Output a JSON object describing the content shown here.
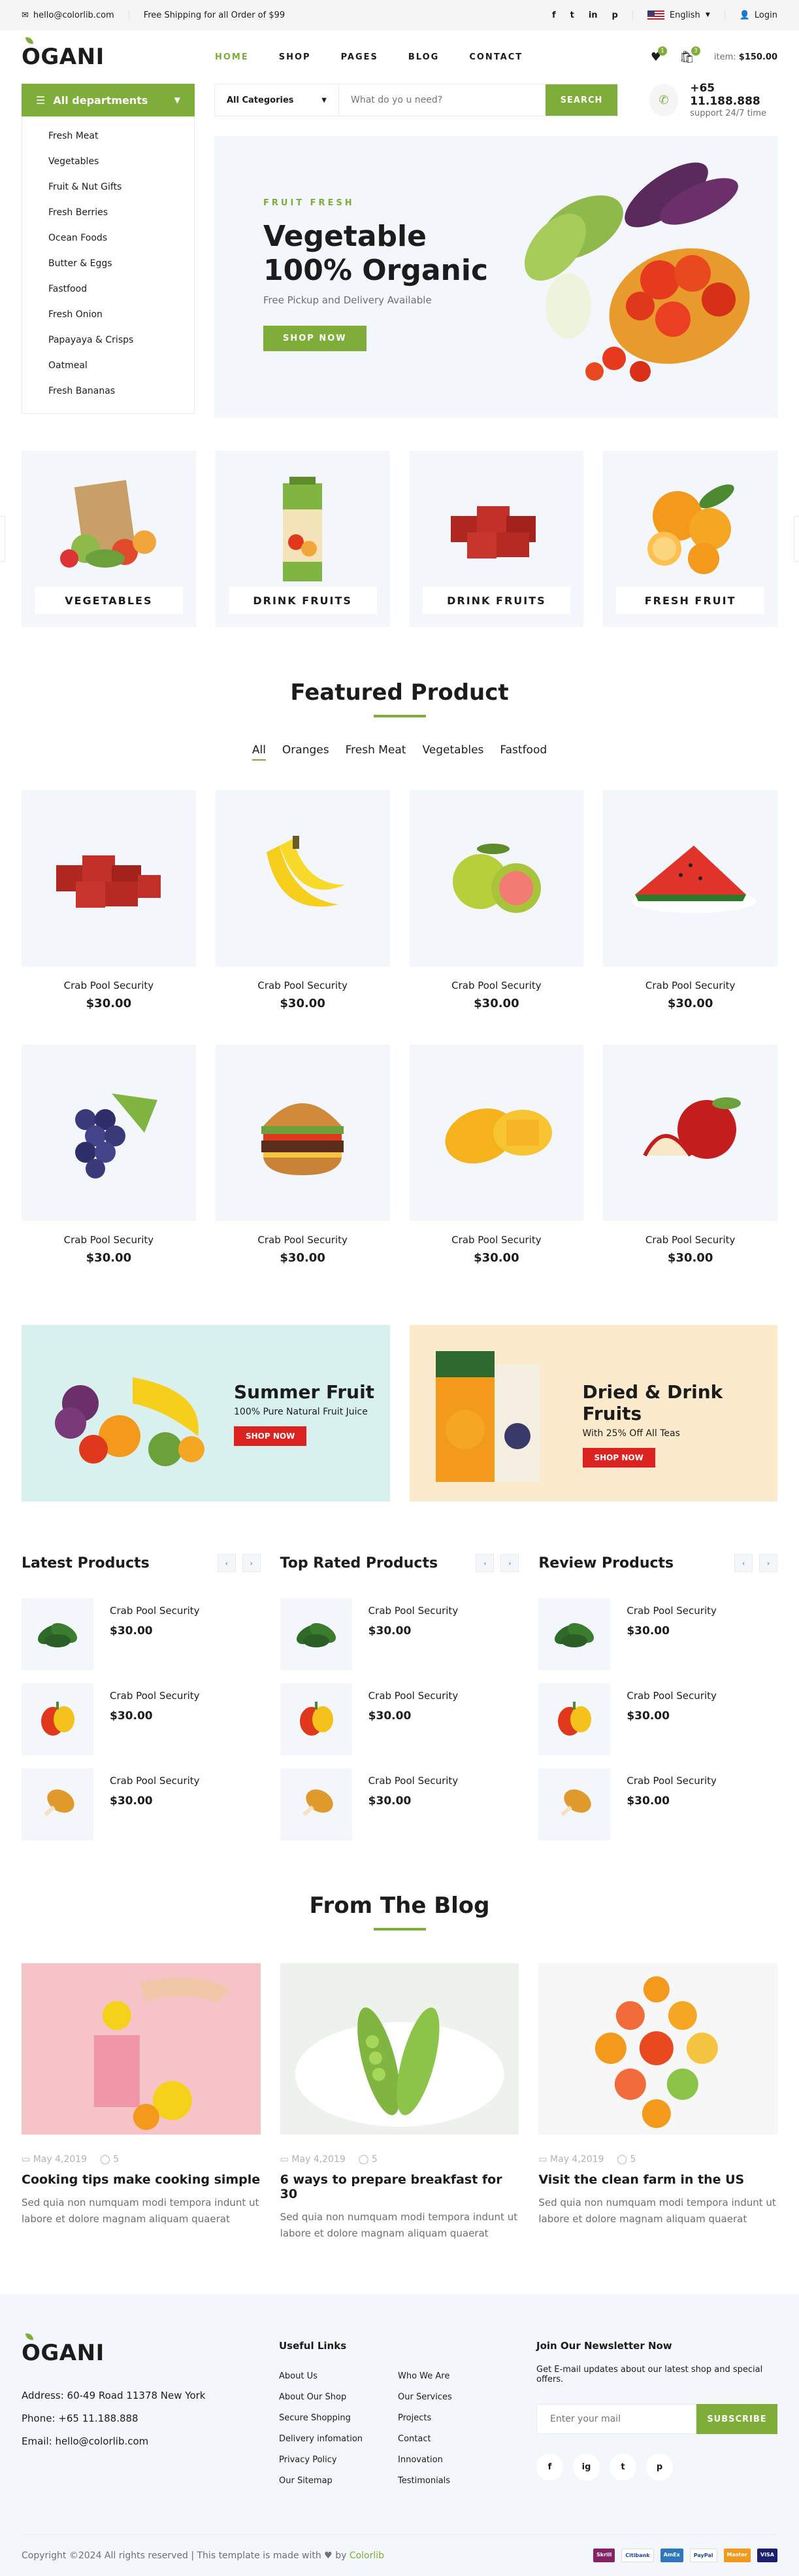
{
  "topbar": {
    "email": "hello@colorlib.com",
    "shipping": "Free Shipping for all Order of $99",
    "social": [
      "f",
      "t",
      "in",
      "p"
    ],
    "language": "English",
    "login": "Login"
  },
  "header": {
    "logo": "OGANI",
    "nav": [
      "HOME",
      "SHOP",
      "PAGES",
      "BLOG",
      "CONTACT"
    ],
    "wishlist_count": "1",
    "cart_count": "3",
    "item_label": "item:",
    "item_price": "$150.00"
  },
  "departments": {
    "title": "All departments",
    "items": [
      "Fresh Meat",
      "Vegetables",
      "Fruit & Nut Gifts",
      "Fresh Berries",
      "Ocean Foods",
      "Butter & Eggs",
      "Fastfood",
      "Fresh Onion",
      "Papayaya & Crisps",
      "Oatmeal",
      "Fresh Bananas"
    ]
  },
  "search": {
    "category": "All Categories",
    "placeholder": "What do yo u need?",
    "button": "SEARCH"
  },
  "phone": {
    "number": "+65 11.188.888",
    "support": "support 24/7 time"
  },
  "banner": {
    "kicker": "FRUIT FRESH",
    "title_line1": "Vegetable",
    "title_line2": "100% Organic",
    "subtitle": "Free Pickup and Delivery Available",
    "button": "SHOP NOW"
  },
  "categories": [
    "VEGETABLES",
    "DRINK FRUITS",
    "DRINK FRUITS",
    "FRESH FRUIT"
  ],
  "featured": {
    "title": "Featured Product",
    "filters": [
      "All",
      "Oranges",
      "Fresh Meat",
      "Vegetables",
      "Fastfood"
    ],
    "products": [
      {
        "name": "Crab Pool Security",
        "price": "$30.00"
      },
      {
        "name": "Crab Pool Security",
        "price": "$30.00"
      },
      {
        "name": "Crab Pool Security",
        "price": "$30.00"
      },
      {
        "name": "Crab Pool Security",
        "price": "$30.00"
      },
      {
        "name": "Crab Pool Security",
        "price": "$30.00"
      },
      {
        "name": "Crab Pool Security",
        "price": "$30.00"
      },
      {
        "name": "Crab Pool Security",
        "price": "$30.00"
      },
      {
        "name": "Crab Pool Security",
        "price": "$30.00"
      }
    ]
  },
  "promos": [
    {
      "title": "Summer Fruit",
      "subtitle": "100% Pure Natural Fruit Juice",
      "button": "SHOP NOW"
    },
    {
      "title": "Dried & Drink Fruits",
      "subtitle": "With 25% Off All Teas",
      "button": "SHOP NOW"
    }
  ],
  "lists": [
    {
      "title": "Latest Products",
      "items": [
        {
          "name": "Crab Pool Security",
          "price": "$30.00"
        },
        {
          "name": "Crab Pool Security",
          "price": "$30.00"
        },
        {
          "name": "Crab Pool Security",
          "price": "$30.00"
        }
      ]
    },
    {
      "title": "Top Rated Products",
      "items": [
        {
          "name": "Crab Pool Security",
          "price": "$30.00"
        },
        {
          "name": "Crab Pool Security",
          "price": "$30.00"
        },
        {
          "name": "Crab Pool Security",
          "price": "$30.00"
        }
      ]
    },
    {
      "title": "Review Products",
      "items": [
        {
          "name": "Crab Pool Security",
          "price": "$30.00"
        },
        {
          "name": "Crab Pool Security",
          "price": "$30.00"
        },
        {
          "name": "Crab Pool Security",
          "price": "$30.00"
        }
      ]
    }
  ],
  "blog": {
    "title": "From The Blog",
    "posts": [
      {
        "date": "May 4,2019",
        "comments": "5",
        "title": "Cooking tips make cooking simple",
        "excerpt": "Sed quia non numquam modi tempora indunt ut labore et dolore magnam aliquam quaerat"
      },
      {
        "date": "May 4,2019",
        "comments": "5",
        "title": "6 ways to prepare breakfast for 30",
        "excerpt": "Sed quia non numquam modi tempora indunt ut labore et dolore magnam aliquam quaerat"
      },
      {
        "date": "May 4,2019",
        "comments": "5",
        "title": "Visit the clean farm in the US",
        "excerpt": "Sed quia non numquam modi tempora indunt ut labore et dolore magnam aliquam quaerat"
      }
    ]
  },
  "footer": {
    "address": "Address: 60-49 Road 11378 New York",
    "phone": "Phone: +65 11.188.888",
    "email": "Email: hello@colorlib.com",
    "links_title": "Useful Links",
    "links": [
      "About Us",
      "Who We Are",
      "About Our Shop",
      "Our Services",
      "Secure Shopping",
      "Projects",
      "Delivery infomation",
      "Contact",
      "Privacy Policy",
      "Innovation",
      "Our Sitemap",
      "Testimonials"
    ],
    "newsletter_title": "Join Our Newsletter Now",
    "newsletter_text": "Get E-mail updates about our latest shop and special offers.",
    "newsletter_placeholder": "Enter your mail",
    "newsletter_button": "SUBSCRIBE",
    "social": [
      "f",
      "ig",
      "t",
      "p"
    ],
    "copyright": "Copyright ©2024 All rights reserved | This template is made with",
    "by": "by",
    "colorlib": "Colorlib",
    "payments": [
      "Skrill",
      "Citibank",
      "AmEx",
      "PayPal",
      "Master",
      "VISA"
    ]
  },
  "colors": {
    "accent": "#7fad39",
    "promo_red": "#dd2222",
    "soft_bg": "#f3f6fa"
  }
}
